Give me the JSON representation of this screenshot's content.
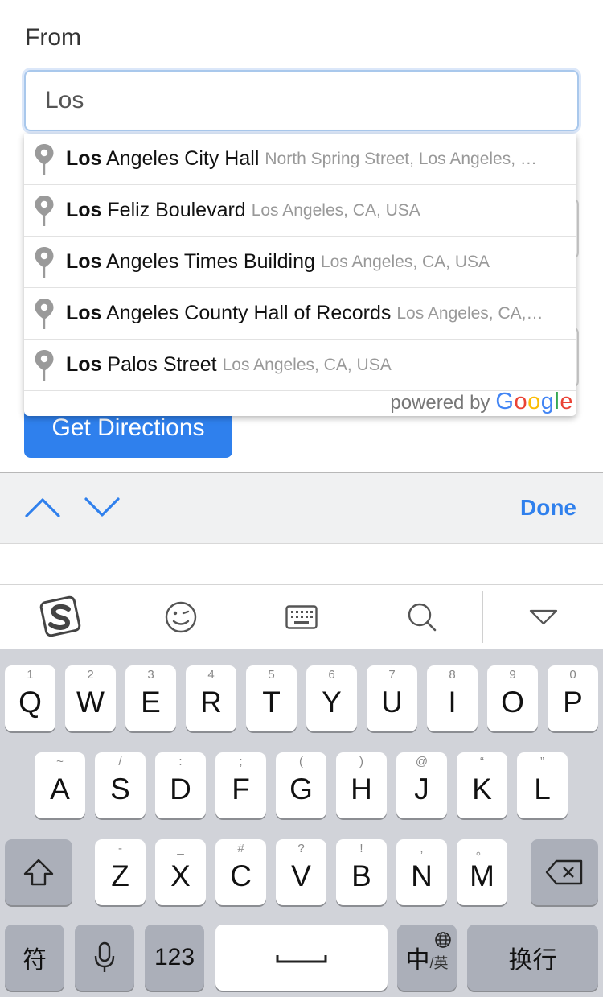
{
  "form": {
    "from_label": "From",
    "from_value": "Los",
    "get_directions": "Get Directions"
  },
  "autocomplete": {
    "suggestions": [
      {
        "match": "Los",
        "rest": " Angeles City Hall",
        "secondary": "North Spring Street, Los Angeles, …"
      },
      {
        "match": "Los",
        "rest": " Feliz Boulevard",
        "secondary": "Los Angeles, CA, USA"
      },
      {
        "match": "Los",
        "rest": " Angeles Times Building",
        "secondary": "Los Angeles, CA, USA"
      },
      {
        "match": "Los",
        "rest": " Angeles County Hall of Records",
        "secondary": "Los Angeles, CA,…"
      },
      {
        "match": "Los",
        "rest": " Palos Street",
        "secondary": "Los Angeles, CA, USA"
      }
    ],
    "powered_by": "powered by",
    "google_letters": [
      "G",
      "o",
      "o",
      "g",
      "l",
      "e"
    ]
  },
  "accessory": {
    "done": "Done",
    "icons": [
      "chevron-up-icon",
      "chevron-down-icon"
    ]
  },
  "ime_toolbar": {
    "icons": [
      "sogou-logo-icon",
      "emoji-icon",
      "keyboard-icon",
      "search-icon",
      "collapse-icon"
    ]
  },
  "keyboard": {
    "row1": [
      {
        "key": "Q",
        "hint": "1"
      },
      {
        "key": "W",
        "hint": "2"
      },
      {
        "key": "E",
        "hint": "3"
      },
      {
        "key": "R",
        "hint": "4"
      },
      {
        "key": "T",
        "hint": "5"
      },
      {
        "key": "Y",
        "hint": "6"
      },
      {
        "key": "U",
        "hint": "7"
      },
      {
        "key": "I",
        "hint": "8"
      },
      {
        "key": "O",
        "hint": "9"
      },
      {
        "key": "P",
        "hint": "0"
      }
    ],
    "row2": [
      {
        "key": "A",
        "hint": "~"
      },
      {
        "key": "S",
        "hint": "/"
      },
      {
        "key": "D",
        "hint": ":"
      },
      {
        "key": "F",
        "hint": ";"
      },
      {
        "key": "G",
        "hint": "("
      },
      {
        "key": "H",
        "hint": ")"
      },
      {
        "key": "J",
        "hint": "@"
      },
      {
        "key": "K",
        "hint": "“"
      },
      {
        "key": "L",
        "hint": "”"
      }
    ],
    "row3": [
      {
        "key": "Z",
        "hint": "-"
      },
      {
        "key": "X",
        "hint": "_"
      },
      {
        "key": "C",
        "hint": "#"
      },
      {
        "key": "V",
        "hint": "?"
      },
      {
        "key": "B",
        "hint": "!"
      },
      {
        "key": "N",
        "hint": ","
      },
      {
        "key": "M",
        "hint": "。"
      }
    ],
    "symbols_key": "符",
    "numbers_key": "123",
    "lang_key_main": "中",
    "lang_key_sub": "/英",
    "return_key": "换行"
  }
}
